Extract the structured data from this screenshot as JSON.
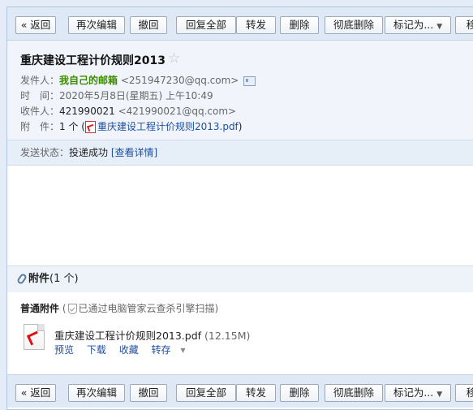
{
  "toolbar": {
    "back": "« 返回",
    "re_edit": "再次编辑",
    "recall": "撤回",
    "reply_all": "回复全部",
    "forward": "转发",
    "delete": "删除",
    "delete_forever": "彻底删除",
    "mark_as": "标记为...",
    "move": "移"
  },
  "mail": {
    "subject": "重庆建设工程计价规则2013",
    "from_label": "发件人：",
    "from_name": "我自己的邮箱",
    "from_email": "<251947230@qq.com>",
    "time_label": "时　间：",
    "time_value": "2020年5月8日(星期五) 上午10:49",
    "to_label": "收件人：",
    "to_name": "421990021",
    "to_email": "<421990021@qq.com>",
    "attach_label": "附　件：",
    "attach_prefix": "1 个 (",
    "attach_file": "重庆建设工程计价规则2013.pdf",
    "attach_suffix": ")"
  },
  "status": {
    "label": "发送状态：",
    "value": "投递成功",
    "details": "[查看详情]"
  },
  "attachments": {
    "title": "附件",
    "count": "(1 个)",
    "type_label": "普通附件",
    "scan_open": "(",
    "scan_text": "已通过电脑管家云查杀引擎扫描",
    "scan_close": ")",
    "file_name": "重庆建设工程计价规则2013.pdf",
    "file_size": "(12.15M)",
    "preview": "预览",
    "download": "下载",
    "collect": "收藏",
    "save_to": "转存",
    "save_to_arrow": "▾"
  },
  "icons": {
    "star": "star-icon",
    "contact_card": "contact-card-icon",
    "pdf": "pdf-icon",
    "paperclip": "paperclip-icon",
    "shield": "shield-icon"
  }
}
